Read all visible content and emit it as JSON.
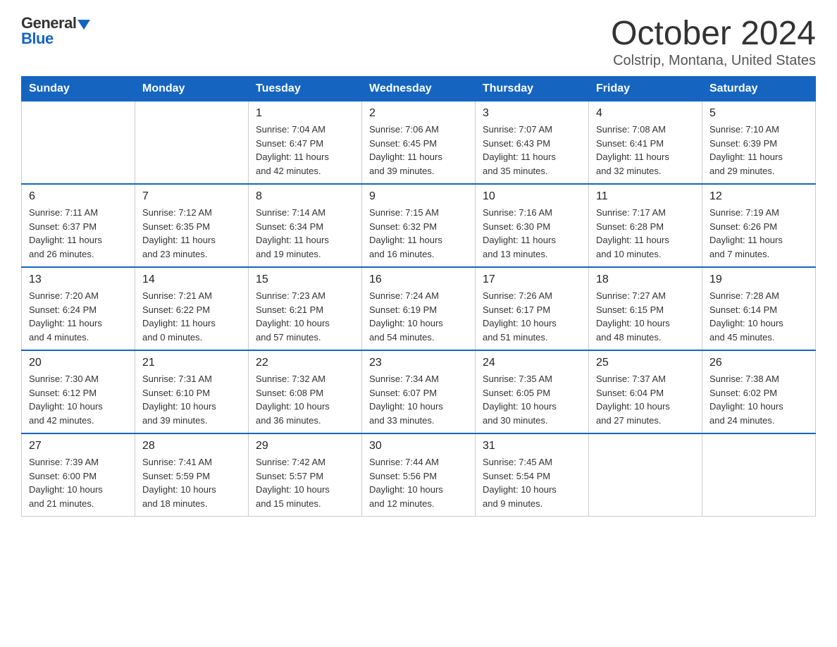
{
  "header": {
    "logo_general": "General",
    "logo_blue": "Blue",
    "title": "October 2024",
    "location": "Colstrip, Montana, United States"
  },
  "days_of_week": [
    "Sunday",
    "Monday",
    "Tuesday",
    "Wednesday",
    "Thursday",
    "Friday",
    "Saturday"
  ],
  "weeks": [
    [
      {
        "day": "",
        "info": ""
      },
      {
        "day": "",
        "info": ""
      },
      {
        "day": "1",
        "info": "Sunrise: 7:04 AM\nSunset: 6:47 PM\nDaylight: 11 hours\nand 42 minutes."
      },
      {
        "day": "2",
        "info": "Sunrise: 7:06 AM\nSunset: 6:45 PM\nDaylight: 11 hours\nand 39 minutes."
      },
      {
        "day": "3",
        "info": "Sunrise: 7:07 AM\nSunset: 6:43 PM\nDaylight: 11 hours\nand 35 minutes."
      },
      {
        "day": "4",
        "info": "Sunrise: 7:08 AM\nSunset: 6:41 PM\nDaylight: 11 hours\nand 32 minutes."
      },
      {
        "day": "5",
        "info": "Sunrise: 7:10 AM\nSunset: 6:39 PM\nDaylight: 11 hours\nand 29 minutes."
      }
    ],
    [
      {
        "day": "6",
        "info": "Sunrise: 7:11 AM\nSunset: 6:37 PM\nDaylight: 11 hours\nand 26 minutes."
      },
      {
        "day": "7",
        "info": "Sunrise: 7:12 AM\nSunset: 6:35 PM\nDaylight: 11 hours\nand 23 minutes."
      },
      {
        "day": "8",
        "info": "Sunrise: 7:14 AM\nSunset: 6:34 PM\nDaylight: 11 hours\nand 19 minutes."
      },
      {
        "day": "9",
        "info": "Sunrise: 7:15 AM\nSunset: 6:32 PM\nDaylight: 11 hours\nand 16 minutes."
      },
      {
        "day": "10",
        "info": "Sunrise: 7:16 AM\nSunset: 6:30 PM\nDaylight: 11 hours\nand 13 minutes."
      },
      {
        "day": "11",
        "info": "Sunrise: 7:17 AM\nSunset: 6:28 PM\nDaylight: 11 hours\nand 10 minutes."
      },
      {
        "day": "12",
        "info": "Sunrise: 7:19 AM\nSunset: 6:26 PM\nDaylight: 11 hours\nand 7 minutes."
      }
    ],
    [
      {
        "day": "13",
        "info": "Sunrise: 7:20 AM\nSunset: 6:24 PM\nDaylight: 11 hours\nand 4 minutes."
      },
      {
        "day": "14",
        "info": "Sunrise: 7:21 AM\nSunset: 6:22 PM\nDaylight: 11 hours\nand 0 minutes."
      },
      {
        "day": "15",
        "info": "Sunrise: 7:23 AM\nSunset: 6:21 PM\nDaylight: 10 hours\nand 57 minutes."
      },
      {
        "day": "16",
        "info": "Sunrise: 7:24 AM\nSunset: 6:19 PM\nDaylight: 10 hours\nand 54 minutes."
      },
      {
        "day": "17",
        "info": "Sunrise: 7:26 AM\nSunset: 6:17 PM\nDaylight: 10 hours\nand 51 minutes."
      },
      {
        "day": "18",
        "info": "Sunrise: 7:27 AM\nSunset: 6:15 PM\nDaylight: 10 hours\nand 48 minutes."
      },
      {
        "day": "19",
        "info": "Sunrise: 7:28 AM\nSunset: 6:14 PM\nDaylight: 10 hours\nand 45 minutes."
      }
    ],
    [
      {
        "day": "20",
        "info": "Sunrise: 7:30 AM\nSunset: 6:12 PM\nDaylight: 10 hours\nand 42 minutes."
      },
      {
        "day": "21",
        "info": "Sunrise: 7:31 AM\nSunset: 6:10 PM\nDaylight: 10 hours\nand 39 minutes."
      },
      {
        "day": "22",
        "info": "Sunrise: 7:32 AM\nSunset: 6:08 PM\nDaylight: 10 hours\nand 36 minutes."
      },
      {
        "day": "23",
        "info": "Sunrise: 7:34 AM\nSunset: 6:07 PM\nDaylight: 10 hours\nand 33 minutes."
      },
      {
        "day": "24",
        "info": "Sunrise: 7:35 AM\nSunset: 6:05 PM\nDaylight: 10 hours\nand 30 minutes."
      },
      {
        "day": "25",
        "info": "Sunrise: 7:37 AM\nSunset: 6:04 PM\nDaylight: 10 hours\nand 27 minutes."
      },
      {
        "day": "26",
        "info": "Sunrise: 7:38 AM\nSunset: 6:02 PM\nDaylight: 10 hours\nand 24 minutes."
      }
    ],
    [
      {
        "day": "27",
        "info": "Sunrise: 7:39 AM\nSunset: 6:00 PM\nDaylight: 10 hours\nand 21 minutes."
      },
      {
        "day": "28",
        "info": "Sunrise: 7:41 AM\nSunset: 5:59 PM\nDaylight: 10 hours\nand 18 minutes."
      },
      {
        "day": "29",
        "info": "Sunrise: 7:42 AM\nSunset: 5:57 PM\nDaylight: 10 hours\nand 15 minutes."
      },
      {
        "day": "30",
        "info": "Sunrise: 7:44 AM\nSunset: 5:56 PM\nDaylight: 10 hours\nand 12 minutes."
      },
      {
        "day": "31",
        "info": "Sunrise: 7:45 AM\nSunset: 5:54 PM\nDaylight: 10 hours\nand 9 minutes."
      },
      {
        "day": "",
        "info": ""
      },
      {
        "day": "",
        "info": ""
      }
    ]
  ]
}
